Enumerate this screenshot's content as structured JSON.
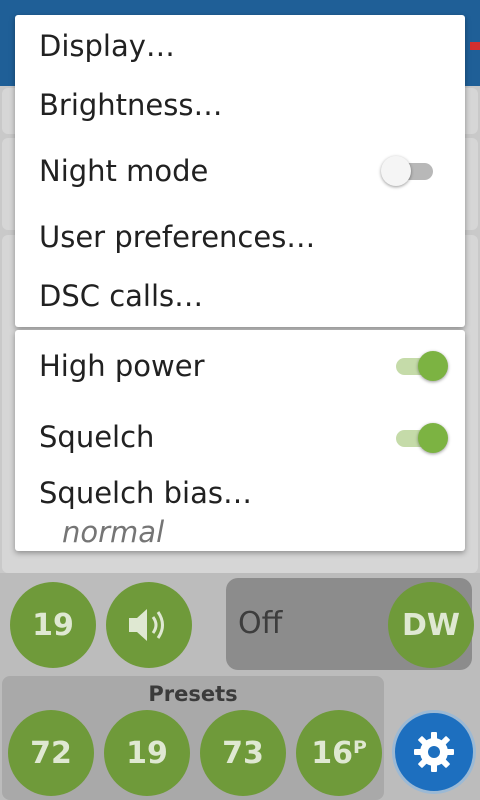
{
  "menu_main": {
    "items": [
      {
        "label": "Display…"
      },
      {
        "label": "Brightness…"
      },
      {
        "label": "Night mode",
        "toggle": false
      },
      {
        "label": "User preferences…"
      },
      {
        "label": "DSC calls…"
      }
    ]
  },
  "menu_radio": {
    "high_power": {
      "label": "High power",
      "toggle": true
    },
    "squelch": {
      "label": "Squelch",
      "toggle": true
    },
    "squelch_bias": {
      "label": "Squelch bias…",
      "value": "normal"
    }
  },
  "background": {
    "channel": "19",
    "watch_status": "Off",
    "dual_watch": "DW",
    "presets_label": "Presets",
    "presets": [
      "72",
      "19",
      "73",
      "16ᴾ"
    ]
  },
  "colors": {
    "app_bar": "#1f5f97",
    "toggle_on": "#7cb342",
    "button_green": "#6f9a3a",
    "settings_button": "#1d6fbf"
  },
  "icons": [
    "speaker-icon",
    "gear-icon"
  ]
}
